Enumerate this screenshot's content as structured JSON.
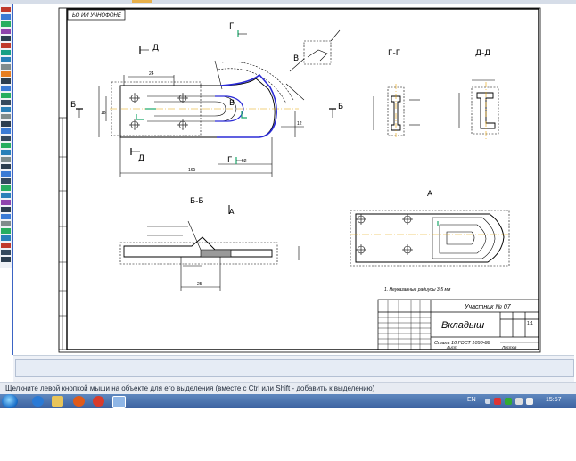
{
  "drawing": {
    "title": "Вкладыш",
    "material": "Сталь 10  ГОСТ 1050-88",
    "student": "Участник № 07",
    "scale": "1:1",
    "note": "1. Неуказанные радиусы 3-5 мм",
    "sheet_label": "Лист",
    "sheets_label": "Листов",
    "stamp_code": "ЬО ИИ УЧНОФОНЕ",
    "sections": {
      "g": "Г-Г",
      "d": "Д-Д",
      "b": "Б-Б",
      "a": "А",
      "letter_g": "Г",
      "letter_d": "Д",
      "letter_b": "Б",
      "letter_v": "В",
      "letter_a": "А"
    },
    "dims": {
      "overall": "165",
      "d52": "52",
      "d18": "18",
      "d25": "25",
      "d12": "12",
      "d24": "24"
    }
  },
  "status": {
    "hint": "Щелкните левой кнопкой мыши на объекте для его выделения (вместе с Ctrl или Shift - добавить к выделению)"
  },
  "taskbar": {
    "lang": "EN",
    "time": "15:57"
  }
}
